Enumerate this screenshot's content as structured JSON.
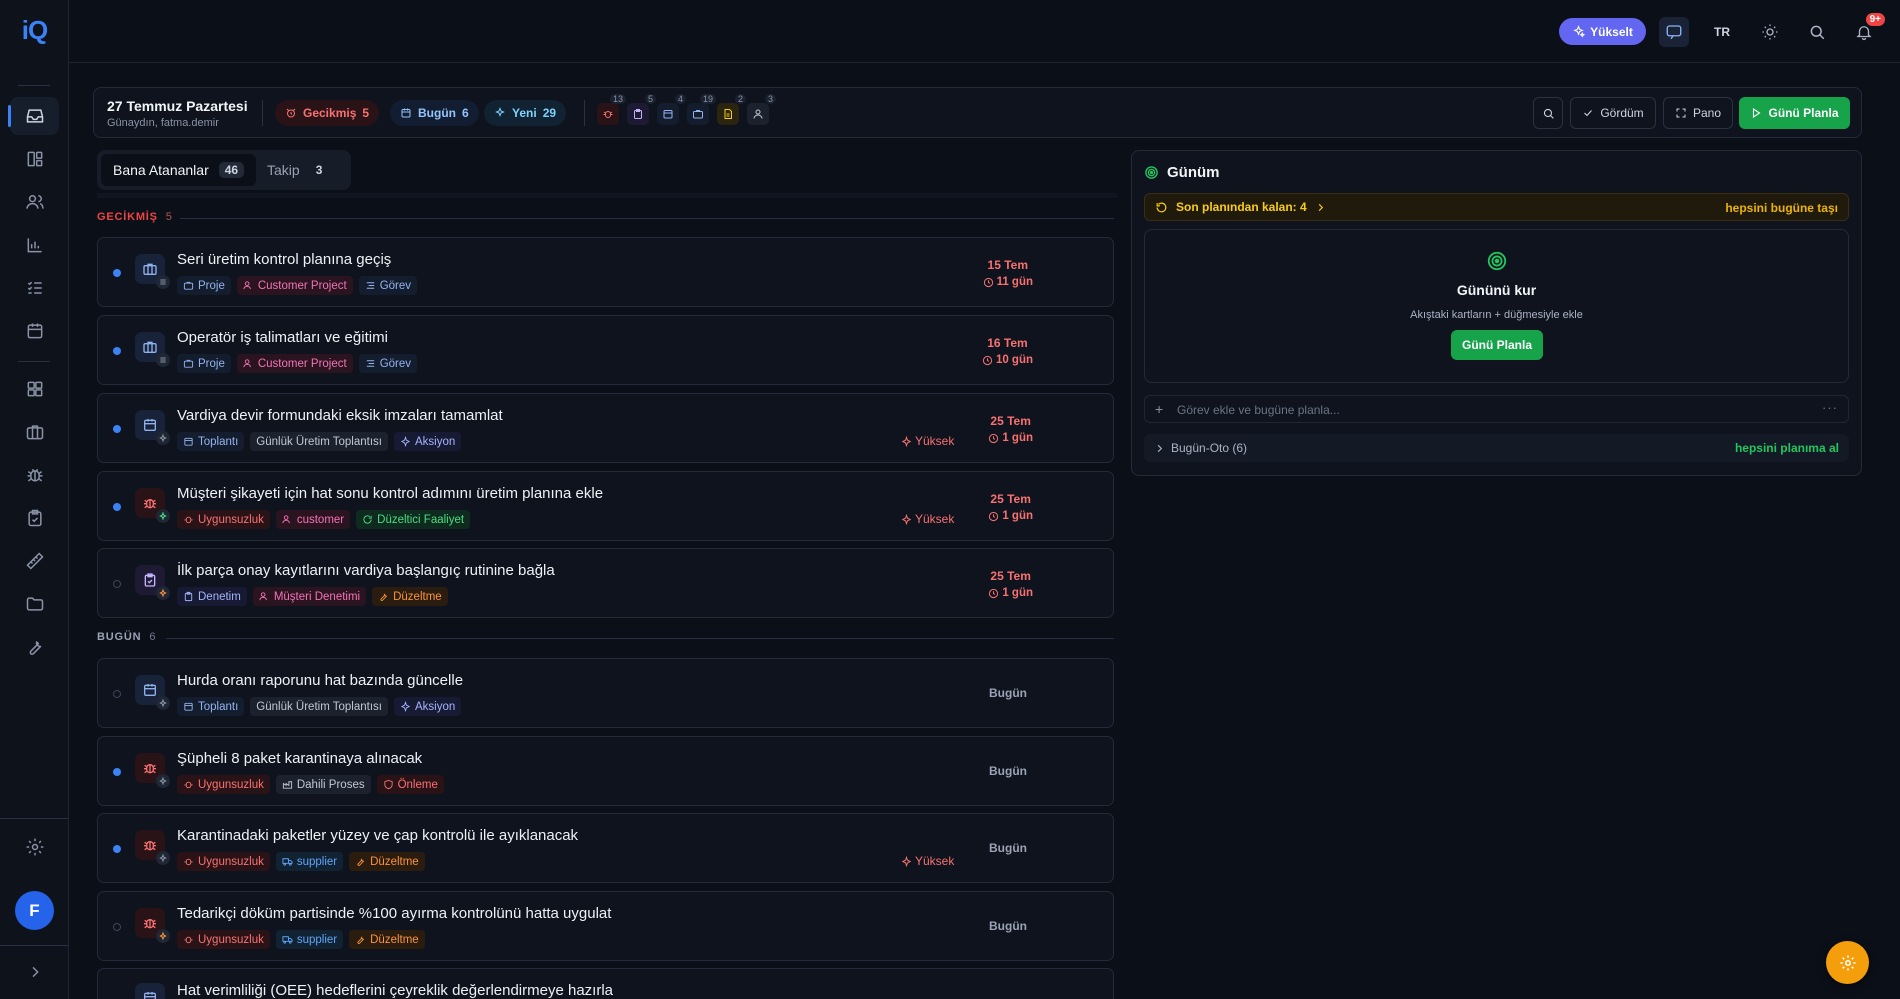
{
  "app": {
    "logo": "iQ"
  },
  "header": {
    "upgrade_label": "Yükselt",
    "lang": "TR",
    "notif_count": "9+"
  },
  "daybar": {
    "date": "27 Temmuz Pazartesi",
    "greeting": "Günaydın, fatma.demir",
    "overdue_label": "Gecikmiş",
    "overdue_count": "5",
    "today_label": "Bugün",
    "today_count": "6",
    "new_label": "Yeni",
    "new_count": "29",
    "mini_counts": [
      "13",
      "5",
      "4",
      "19",
      "2",
      "3"
    ],
    "seen_label": "Gördüm",
    "board_label": "Pano",
    "plan_label": "Günü Planla"
  },
  "tabs": [
    {
      "label": "Bana Atananlar",
      "count": "46"
    },
    {
      "label": "Takip",
      "count": "3"
    }
  ],
  "sections": {
    "overdue": {
      "label": "GECİKMİŞ",
      "count": "5"
    },
    "today": {
      "label": "BUGÜN",
      "count": "6"
    }
  },
  "overdue_tasks": [
    {
      "title": "Seri üretim kontrol planına geçiş",
      "tags": [
        "Proje",
        "Customer Project",
        "Görev"
      ],
      "priority": "",
      "due": "15 Tem",
      "ago": "11 gün"
    },
    {
      "title": "Operatör iş talimatları ve eğitimi",
      "tags": [
        "Proje",
        "Customer Project",
        "Görev"
      ],
      "priority": "",
      "due": "16 Tem",
      "ago": "10 gün"
    },
    {
      "title": "Vardiya devir formundaki eksik imzaları tamamlat",
      "tags": [
        "Toplantı",
        "Günlük Üretim Toplantısı",
        "Aksiyon"
      ],
      "priority": "Yüksek",
      "due": "25 Tem",
      "ago": "1 gün"
    },
    {
      "title": "Müşteri şikayeti için hat sonu kontrol adımını üretim planına ekle",
      "tags": [
        "Uygunsuzluk",
        "customer",
        "Düzeltici Faaliyet"
      ],
      "priority": "Yüksek",
      "due": "25 Tem",
      "ago": "1 gün"
    },
    {
      "title": "İlk parça onay kayıtlarını vardiya başlangıç rutinine bağla",
      "tags": [
        "Denetim",
        "Müşteri Denetimi",
        "Düzeltme"
      ],
      "priority": "",
      "due": "25 Tem",
      "ago": "1 gün"
    }
  ],
  "today_tasks": [
    {
      "title": "Hurda oranı raporunu hat bazında güncelle",
      "tags": [
        "Toplantı",
        "Günlük Üretim Toplantısı",
        "Aksiyon"
      ],
      "priority": "",
      "due": "Bugün"
    },
    {
      "title": "Şüpheli 8 paket karantinaya alınacak",
      "tags": [
        "Uygunsuzluk",
        "Dahili Proses",
        "Önleme"
      ],
      "priority": "",
      "due": "Bugün"
    },
    {
      "title": "Karantinadaki paketler yüzey ve çap kontrolü ile ayıklanacak",
      "tags": [
        "Uygunsuzluk",
        "supplier",
        "Düzeltme"
      ],
      "priority": "Yüksek",
      "due": "Bugün"
    },
    {
      "title": "Tedarikçi döküm partisinde %100 ayırma kontrolünü hatta uygulat",
      "tags": [
        "Uygunsuzluk",
        "supplier",
        "Düzeltme"
      ],
      "priority": "",
      "due": "Bugün"
    },
    {
      "title": "Hat verimliliği (OEE) hedeflerini çeyreklik değerlendirmeye hazırla"
    }
  ],
  "panel": {
    "title": "Günüm",
    "leftover": "Son planından kalan: 4",
    "move_all": "hepsini bugüne taşı",
    "setup_title": "Gününü kur",
    "setup_hint": "Akıştaki kartların + düğmesiyle ekle",
    "setup_button": "Günü Planla",
    "add_placeholder": "Görev ekle ve bugüne planla...",
    "auto_label": "Bugün-Oto (6)",
    "take_all": "hepsini planıma al"
  }
}
